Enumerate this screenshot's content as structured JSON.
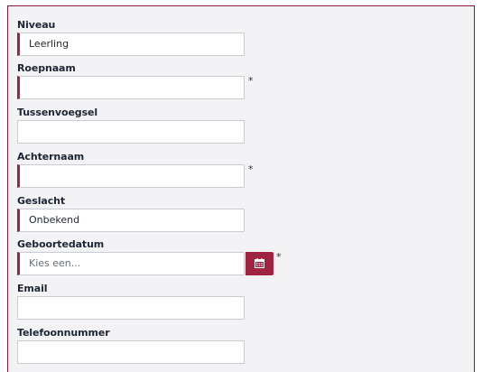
{
  "form": {
    "niveau": {
      "label": "Niveau",
      "value": "Leerling"
    },
    "roepnaam": {
      "label": "Roepnaam",
      "value": "",
      "required_marker": "*"
    },
    "tussenvoegsel": {
      "label": "Tussenvoegsel",
      "value": ""
    },
    "achternaam": {
      "label": "Achternaam",
      "value": "",
      "required_marker": "*"
    },
    "geslacht": {
      "label": "Geslacht",
      "value": "Onbekend"
    },
    "geboortedatum": {
      "label": "Geboortedatum",
      "placeholder": "Kies een...",
      "required_marker": "*"
    },
    "email": {
      "label": "Email",
      "value": ""
    },
    "telefoonnummer": {
      "label": "Telefoonnummer",
      "value": ""
    }
  },
  "icons": {
    "calendar": "calendar-icon"
  },
  "colors": {
    "accent": "#a0243f",
    "panel_background": "#f3f3f5",
    "panel_border": "#8a1a35"
  }
}
